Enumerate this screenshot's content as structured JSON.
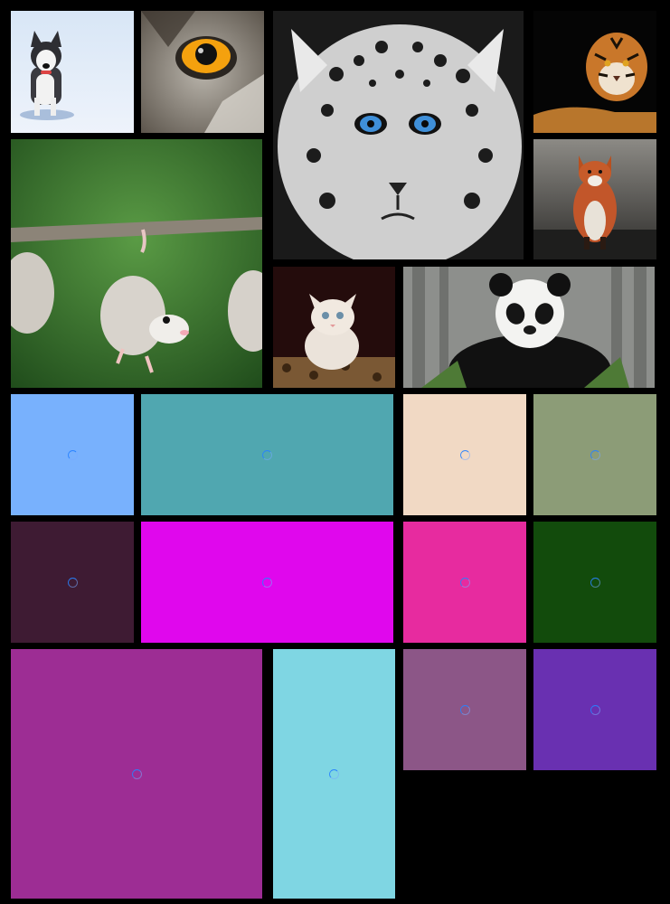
{
  "gallery": {
    "photos": [
      {
        "id": "husky",
        "icon": "husky-dog-photo"
      },
      {
        "id": "owl",
        "icon": "owl-eye-photo"
      },
      {
        "id": "snow-leopard",
        "icon": "snow-leopard-photo"
      },
      {
        "id": "tiger",
        "icon": "tiger-photo"
      },
      {
        "id": "opossums",
        "icon": "opossums-on-branch-photo"
      },
      {
        "id": "fox",
        "icon": "red-fox-photo"
      },
      {
        "id": "kitten",
        "icon": "white-kitten-photo"
      },
      {
        "id": "panda",
        "icon": "giant-panda-photo"
      }
    ],
    "placeholders": [
      {
        "color": "#78b1fd"
      },
      {
        "color": "#50a7b0"
      },
      {
        "color": "#f1d9c4"
      },
      {
        "color": "#8c9c77"
      },
      {
        "color": "#3e1b33"
      },
      {
        "color": "#e007ed"
      },
      {
        "color": "#e72b9f"
      },
      {
        "color": "#124b0c"
      },
      {
        "color": "#9d2d94"
      },
      {
        "color": "#7fd6e3"
      },
      {
        "color": "#8c5687"
      },
      {
        "color": "#6930b1"
      }
    ]
  }
}
